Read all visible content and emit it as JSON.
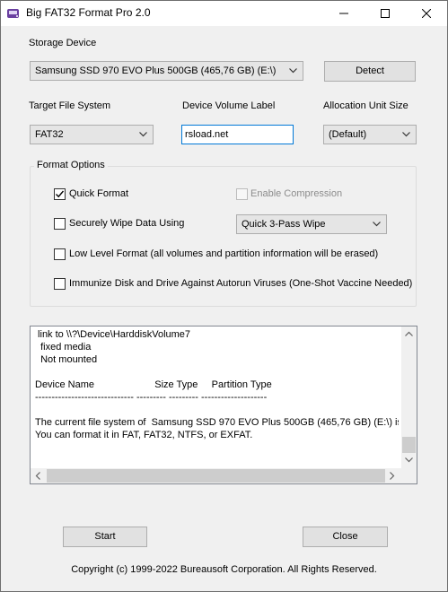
{
  "window": {
    "title": "Big FAT32 Format Pro 2.0",
    "controls": [
      "minimize",
      "maximize",
      "close"
    ]
  },
  "storage": {
    "label": "Storage Device",
    "selected": "Samsung SSD 970 EVO Plus 500GB (465,76 GB) (E:\\)",
    "detect_label": "Detect"
  },
  "target_fs": {
    "label": "Target File System",
    "selected": "FAT32"
  },
  "volume_label": {
    "label": "Device Volume Label",
    "value": "rsload.net"
  },
  "alloc": {
    "label": "Allocation Unit Size",
    "selected": "(Default)"
  },
  "options": {
    "title": "Format Options",
    "quick_format": "Quick Format",
    "quick_format_checked": true,
    "enable_compression": "Enable Compression",
    "enable_compression_enabled": false,
    "secure_wipe": "Securely Wipe Data Using",
    "secure_wipe_checked": false,
    "wipe_method": "Quick 3-Pass Wipe",
    "low_level": "Low Level Format (all volumes and partition information will be erased)",
    "low_level_checked": false,
    "immunize": "Immunize Disk and Drive Against Autorun Viruses (One-Shot Vaccine Needed)",
    "immunize_checked": false
  },
  "log": {
    "lines": [
      " link to \\\\?\\Device\\HarddiskVolume7",
      "  fixed media",
      "  Not mounted",
      "",
      "Device Name                      Size Type     Partition Type",
      "------------------------------ --------- --------- --------------------",
      "",
      "The current file system of  Samsung SSD 970 EVO Plus 500GB (465,76 GB) (E:\\) is",
      "You can format it in FAT, FAT32, NTFS, or EXFAT."
    ]
  },
  "buttons": {
    "start": "Start",
    "close": "Close"
  },
  "footer": {
    "copyright": "Copyright (c) 1999-2022 Bureausoft Corporation. All Rights Reserved."
  },
  "colors": {
    "window_bg": "#f0f0f0",
    "accent_border": "#0078d7"
  }
}
